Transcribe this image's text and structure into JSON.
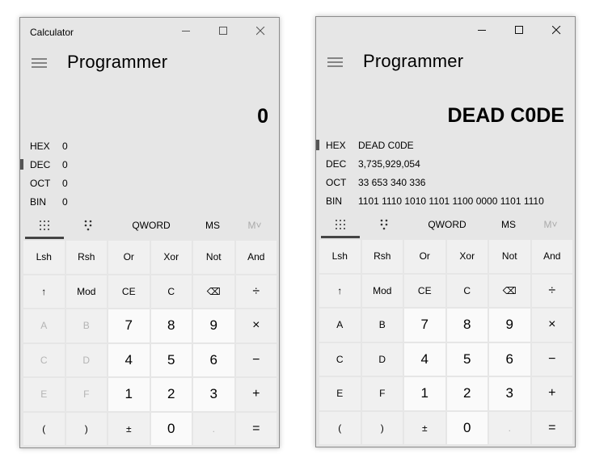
{
  "windows": [
    {
      "title": "Calculator",
      "mode": "Programmer",
      "display": "0",
      "radix": [
        {
          "label": "HEX",
          "value": "0",
          "active": false
        },
        {
          "label": "DEC",
          "value": "0",
          "active": true
        },
        {
          "label": "OCT",
          "value": "0",
          "active": false
        },
        {
          "label": "BIN",
          "value": "0",
          "active": false
        }
      ],
      "toolbar": {
        "word_size": "QWORD",
        "ms": "MS",
        "mv": "M˅"
      },
      "keys": [
        {
          "label": "Lsh",
          "kind": "fn"
        },
        {
          "label": "Rsh",
          "kind": "fn"
        },
        {
          "label": "Or",
          "kind": "fn"
        },
        {
          "label": "Xor",
          "kind": "fn"
        },
        {
          "label": "Not",
          "kind": "fn"
        },
        {
          "label": "And",
          "kind": "fn"
        },
        {
          "label": "↑",
          "kind": "fn"
        },
        {
          "label": "Mod",
          "kind": "fn"
        },
        {
          "label": "CE",
          "kind": "fn"
        },
        {
          "label": "C",
          "kind": "fn"
        },
        {
          "label": "⌫",
          "kind": "fn"
        },
        {
          "label": "÷",
          "kind": "op"
        },
        {
          "label": "A",
          "kind": "dis"
        },
        {
          "label": "B",
          "kind": "dis"
        },
        {
          "label": "7",
          "kind": "num"
        },
        {
          "label": "8",
          "kind": "num"
        },
        {
          "label": "9",
          "kind": "num"
        },
        {
          "label": "×",
          "kind": "op"
        },
        {
          "label": "C",
          "kind": "dis"
        },
        {
          "label": "D",
          "kind": "dis"
        },
        {
          "label": "4",
          "kind": "num"
        },
        {
          "label": "5",
          "kind": "num"
        },
        {
          "label": "6",
          "kind": "num"
        },
        {
          "label": "−",
          "kind": "op"
        },
        {
          "label": "E",
          "kind": "dis"
        },
        {
          "label": "F",
          "kind": "dis"
        },
        {
          "label": "1",
          "kind": "num"
        },
        {
          "label": "2",
          "kind": "num"
        },
        {
          "label": "3",
          "kind": "num"
        },
        {
          "label": "+",
          "kind": "op"
        },
        {
          "label": "(",
          "kind": "fn"
        },
        {
          "label": ")",
          "kind": "fn"
        },
        {
          "label": "±",
          "kind": "fn"
        },
        {
          "label": "0",
          "kind": "num"
        },
        {
          "label": ".",
          "kind": "dis"
        },
        {
          "label": "=",
          "kind": "op"
        }
      ]
    },
    {
      "title": "",
      "mode": "Programmer",
      "display": "DEAD C0DE",
      "radix": [
        {
          "label": "HEX",
          "value": "DEAD C0DE",
          "active": true
        },
        {
          "label": "DEC",
          "value": "3,735,929,054",
          "active": false
        },
        {
          "label": "OCT",
          "value": "33 653 340 336",
          "active": false
        },
        {
          "label": "BIN",
          "value": "1101 1110 1010 1101 1100 0000 1101 1110",
          "active": false
        }
      ],
      "toolbar": {
        "word_size": "QWORD",
        "ms": "MS",
        "mv": "M˅"
      },
      "keys": [
        {
          "label": "Lsh",
          "kind": "fn"
        },
        {
          "label": "Rsh",
          "kind": "fn"
        },
        {
          "label": "Or",
          "kind": "fn"
        },
        {
          "label": "Xor",
          "kind": "fn"
        },
        {
          "label": "Not",
          "kind": "fn"
        },
        {
          "label": "And",
          "kind": "fn"
        },
        {
          "label": "↑",
          "kind": "fn"
        },
        {
          "label": "Mod",
          "kind": "fn"
        },
        {
          "label": "CE",
          "kind": "fn"
        },
        {
          "label": "C",
          "kind": "fn"
        },
        {
          "label": "⌫",
          "kind": "fn"
        },
        {
          "label": "÷",
          "kind": "op"
        },
        {
          "label": "A",
          "kind": "fn"
        },
        {
          "label": "B",
          "kind": "fn"
        },
        {
          "label": "7",
          "kind": "num"
        },
        {
          "label": "8",
          "kind": "num"
        },
        {
          "label": "9",
          "kind": "num"
        },
        {
          "label": "×",
          "kind": "op"
        },
        {
          "label": "C",
          "kind": "fn"
        },
        {
          "label": "D",
          "kind": "fn"
        },
        {
          "label": "4",
          "kind": "num"
        },
        {
          "label": "5",
          "kind": "num"
        },
        {
          "label": "6",
          "kind": "num"
        },
        {
          "label": "−",
          "kind": "op"
        },
        {
          "label": "E",
          "kind": "fn"
        },
        {
          "label": "F",
          "kind": "fn"
        },
        {
          "label": "1",
          "kind": "num"
        },
        {
          "label": "2",
          "kind": "num"
        },
        {
          "label": "3",
          "kind": "num"
        },
        {
          "label": "+",
          "kind": "op"
        },
        {
          "label": "(",
          "kind": "fn"
        },
        {
          "label": ")",
          "kind": "fn"
        },
        {
          "label": "±",
          "kind": "fn"
        },
        {
          "label": "0",
          "kind": "num"
        },
        {
          "label": ".",
          "kind": "dis"
        },
        {
          "label": "=",
          "kind": "op"
        }
      ]
    }
  ]
}
